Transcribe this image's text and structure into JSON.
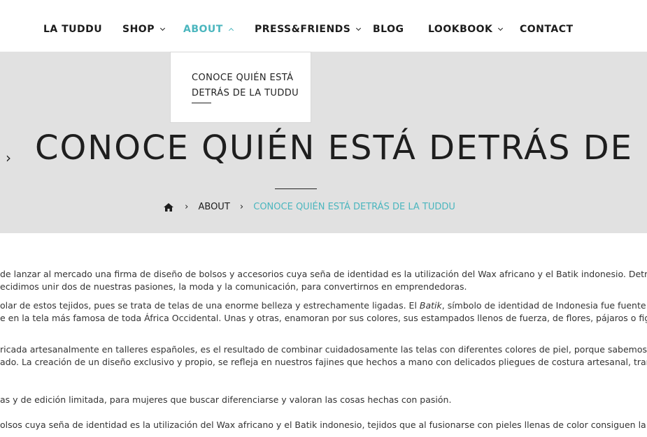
{
  "nav": {
    "items": [
      {
        "label": "LA TUDDU"
      },
      {
        "label": "SHOP"
      },
      {
        "label": "ABOUT"
      },
      {
        "label": "PRESS&FRIENDS"
      },
      {
        "label": "BLOG"
      },
      {
        "label": "LOOKBOOK"
      },
      {
        "label": "CONTACT"
      }
    ],
    "active_color": "#4bb6be"
  },
  "dropdown": {
    "item_label": "CONOCE QUIÉN ESTÁ DETRÁS DE LA TUDDU"
  },
  "hero": {
    "title": "CONOCE QUIÉN ESTÁ DETRÁS DE LA TUDDU",
    "arrow": "›",
    "background": "#e1e1e1"
  },
  "breadcrumb": {
    "separator": "›",
    "parent": "ABOUT",
    "current": "CONOCE QUIÉN ESTÁ DETRÁS DE LA TUDDU"
  },
  "content": {
    "p1_l1": " de lanzar al mercado una firma de diseño de bolsos y accesorios cuya seña de identidad es la utilización del Wax africano y el Batik indonesio. Detrás de ella, estamos",
    "p1_l2": "ecidimos unir dos de nuestras pasiones, la moda y la comunicación, para convertirnos en emprendedoras.",
    "p2_l1a": "olar de estos tejidos, pues se trata de telas de una enorme belleza y estrechamente ligadas. El ",
    "p2_l1_em": "Batik",
    "p2_l1b": ", símbolo de identidad de Indonesia fue fuente de inspiración para la",
    "p2_l2": "e en la tela más famosa de toda África Occidental. Unas y otras, enamoran por sus colores, sus estampados llenos de fuerza, de flores, pájaros o figuras geométricas que",
    "p3_l1": "ricada artesanalmente en talleres españoles, es el resultado de combinar cuidadosamente las telas con diferentes colores de piel, porque sabemos que cada estampado",
    "p3_l2": "ado. La creación de un diseño exclusivo y propio, se refleja en nuestros fajines que hechos a mano con delicados pliegues de costura artesanal, transfieren personalidad",
    "p4_l1": "as y de edición limitada, para mujeres que buscar diferenciarse y valoran las cosas hechas con pasión.",
    "p5_l1": "olsos cuya seña de identidad es la utilización del Wax africano y el Batik indonesio, tejidos que al fusionarse con pieles llenas de color consiguen la combinación perfe"
  }
}
